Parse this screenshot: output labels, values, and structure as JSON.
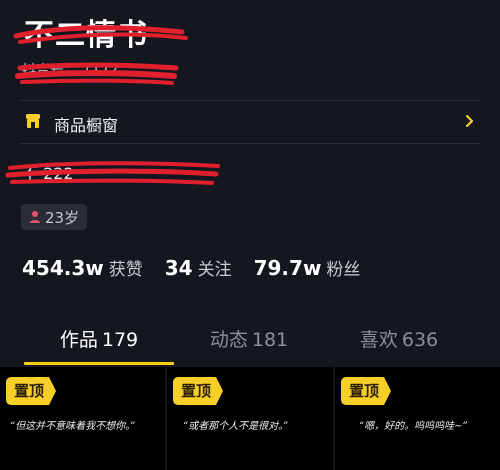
{
  "profile": {
    "name": "不二情书",
    "id_text": "抖音号：  1172",
    "bio_text": "不    222",
    "age_label": "23岁"
  },
  "shop": {
    "label": "商品橱窗"
  },
  "stats": [
    {
      "value": "454.3w",
      "label": "获赞"
    },
    {
      "value": "34",
      "label": "关注"
    },
    {
      "value": "79.7w",
      "label": "粉丝"
    }
  ],
  "tabs": [
    {
      "label": "作品",
      "count": "179",
      "active": true
    },
    {
      "label": "动态",
      "count": "181",
      "active": false
    },
    {
      "label": "喜欢",
      "count": "636",
      "active": false
    }
  ],
  "videos": [
    {
      "pin_label": "置顶",
      "caption": "“但这并不意味着我不想你。”"
    },
    {
      "pin_label": "置顶",
      "caption": "“或者那个人不是很对。”"
    },
    {
      "pin_label": "置顶",
      "caption": "“嗯，好的。呜呜呜哇~”"
    }
  ],
  "colors": {
    "background": "#15171f",
    "accent": "#face15",
    "redaction": "#e0202c",
    "pin_badge": "#f8cf28"
  }
}
